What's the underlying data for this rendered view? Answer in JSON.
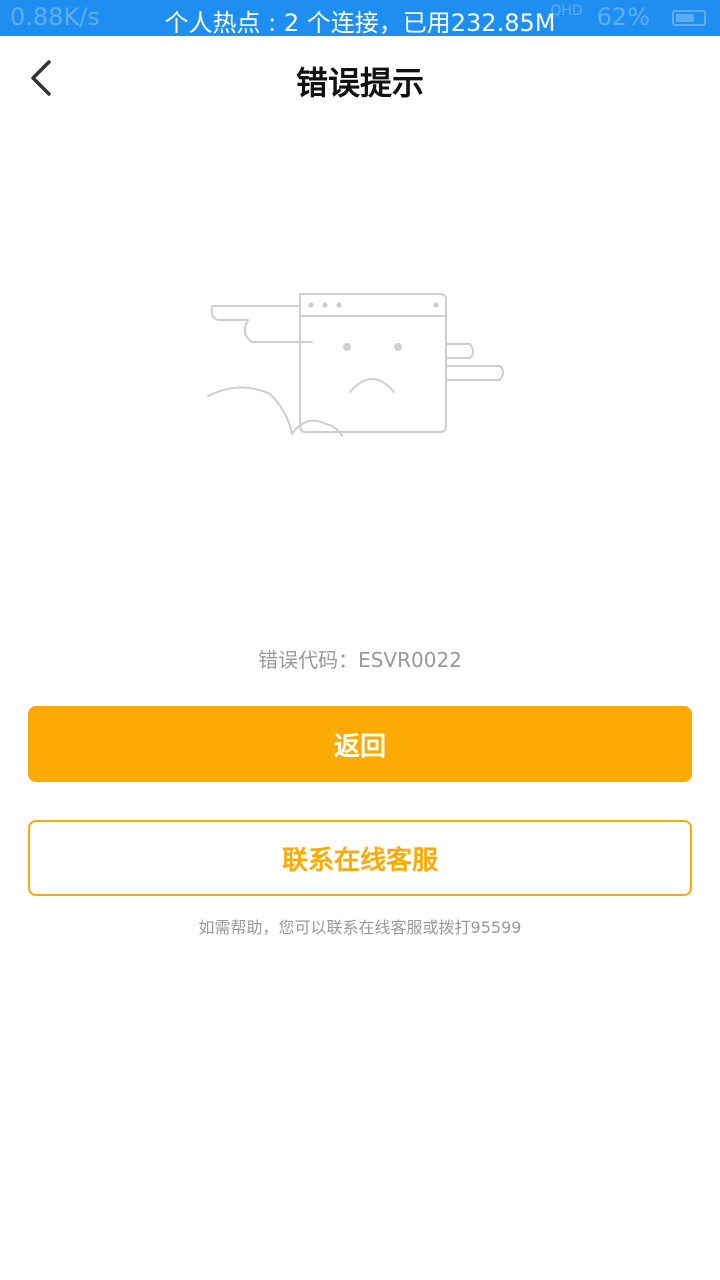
{
  "status_bar": {
    "speed": "0.88K/s",
    "hotspot_text": "个人热点 : 2 个连接，已用232.85M",
    "network": "QHD",
    "battery": "62%",
    "color": "#1f8ef1"
  },
  "nav": {
    "back_icon": "chevron-left-icon",
    "title": "错误提示"
  },
  "illustration": {
    "icon": "sad-browser-window-illustration"
  },
  "error": {
    "label": "错误代码：ESVR0022"
  },
  "actions": {
    "back_label": "返回",
    "service_label": "联系在线客服",
    "accent_color": "#fbab04"
  },
  "help": {
    "text": "如需帮助，您可以联系在线客服或拨打95599"
  }
}
